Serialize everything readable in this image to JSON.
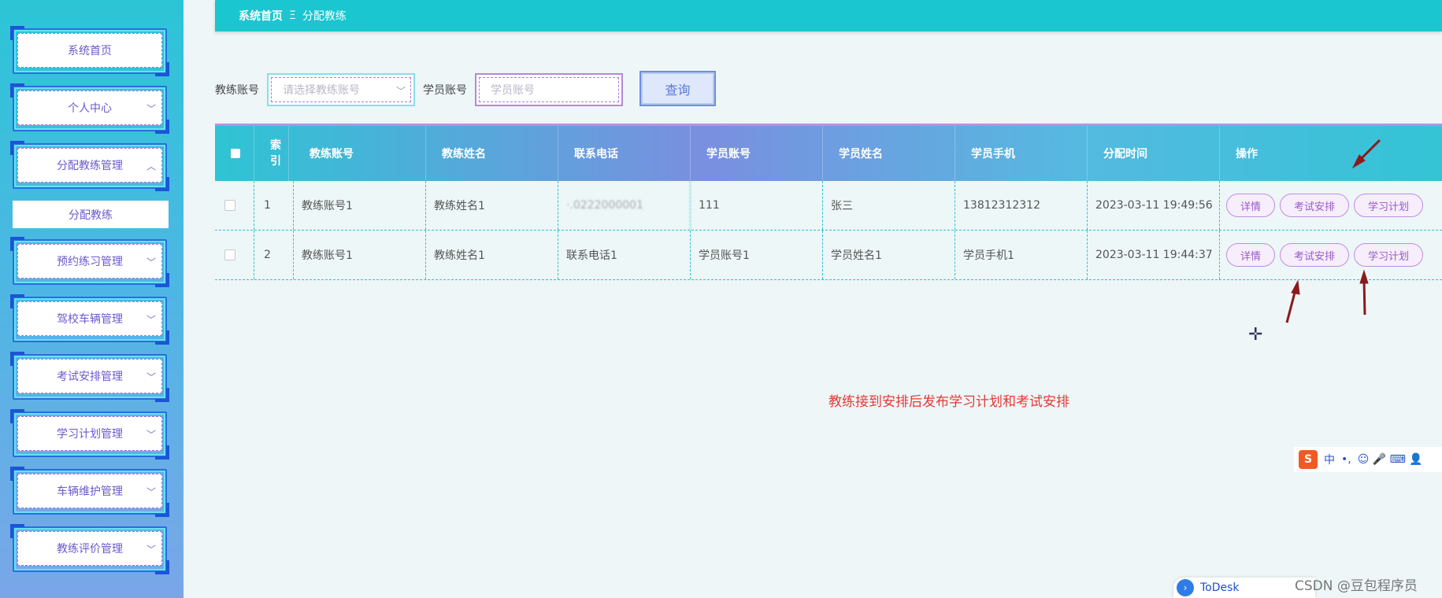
{
  "sidebar": {
    "items": [
      {
        "label": "系统首页",
        "has_chevron": false
      },
      {
        "label": "个人中心",
        "has_chevron": true,
        "chevron": "﹀"
      },
      {
        "label": "分配教练管理",
        "has_chevron": true,
        "chevron": "︿"
      },
      {
        "label": "预约练习管理",
        "has_chevron": true,
        "chevron": "﹀"
      },
      {
        "label": "驾校车辆管理",
        "has_chevron": true,
        "chevron": "﹀"
      },
      {
        "label": "考试安排管理",
        "has_chevron": true,
        "chevron": "﹀"
      },
      {
        "label": "学习计划管理",
        "has_chevron": true,
        "chevron": "﹀"
      },
      {
        "label": "车辆维护管理",
        "has_chevron": true,
        "chevron": "﹀"
      },
      {
        "label": "教练评价管理",
        "has_chevron": true,
        "chevron": "﹀"
      }
    ],
    "submenu_label": "分配教练"
  },
  "breadcrumb": {
    "home": "系统首页",
    "separator": "Ξ",
    "current": "分配教练"
  },
  "search": {
    "coach_label": "教练账号",
    "coach_placeholder": "请选择教练账号",
    "student_label": "学员账号",
    "student_placeholder": "学员账号",
    "query_label": "查询"
  },
  "table": {
    "headers": [
      "索引",
      "教练账号",
      "教练姓名",
      "联系电话",
      "学员账号",
      "学员姓名",
      "学员手机",
      "分配时间",
      "操作"
    ],
    "rows": [
      {
        "index": "1",
        "coach_account": "教练账号1",
        "coach_name": "教练姓名1",
        "phone": "·.0222000001",
        "student_account": "111",
        "student_name": "张三",
        "student_phone": "13812312312",
        "time": "2023-03-11 19:49:56"
      },
      {
        "index": "2",
        "coach_account": "教练账号1",
        "coach_name": "教练姓名1",
        "phone": "联系电话1",
        "student_account": "学员账号1",
        "student_name": "学员姓名1",
        "student_phone": "学员手机1",
        "time": "2023-03-11 19:44:37"
      }
    ],
    "actions": {
      "detail": "详情",
      "exam": "考试安排",
      "plan": "学习计划"
    }
  },
  "annotation": "教练接到安排后发布学习计划和考试安排",
  "ime": {
    "logo": "S",
    "lang": "中",
    "punct": "•,",
    "icons": "☺ 🎤 ⌨ 👤"
  },
  "todesk": {
    "arrow": "›",
    "label": "ToDesk"
  },
  "watermark": "CSDN @豆包程序员"
}
